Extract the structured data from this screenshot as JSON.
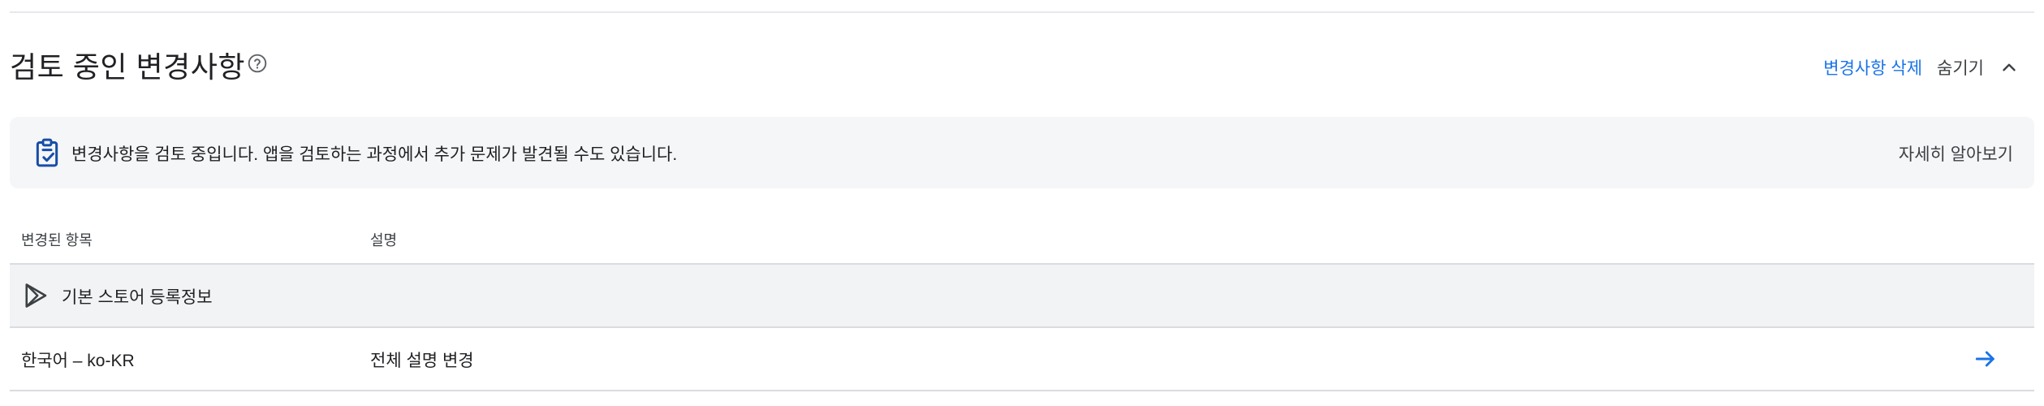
{
  "section": {
    "title": "검토 중인 변경사항",
    "help_icon": "help-circle-icon",
    "discard_label": "변경사항 삭제",
    "hide_label": "숨기기",
    "collapse_icon": "chevron-up-icon",
    "accent_color": "#1a73e8"
  },
  "banner": {
    "icon": "clipboard-check-icon",
    "text": "변경사항을 검토 중입니다. 앱을 검토하는 과정에서 추가 문제가 발견될 수도 있습니다.",
    "learn_more_label": "자세히 알아보기"
  },
  "table": {
    "columns": [
      "변경된 항목",
      "설명"
    ],
    "groups": [
      {
        "icon": "google-play-icon",
        "label": "기본 스토어 등록정보",
        "rows": [
          {
            "item": "한국어 – ko-KR",
            "description": "전체 설명 변경",
            "action_icon": "arrow-forward-icon"
          }
        ]
      }
    ]
  }
}
